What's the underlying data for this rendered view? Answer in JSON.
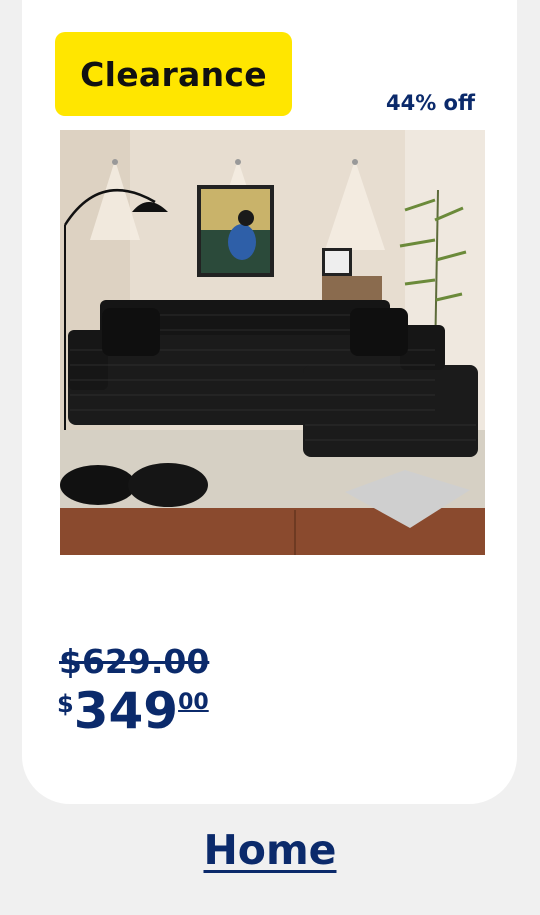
{
  "card": {
    "badge_label": "Clearance",
    "discount_text": "44% off",
    "product_image_alt": "Black corduroy L-shaped sectional sofa",
    "was_price": "$629.00",
    "now_price": {
      "currency": "$",
      "dollars": "349",
      "cents": "00"
    }
  },
  "category_link": "Home",
  "colors": {
    "badge_bg": "#ffe600",
    "text_blue": "#0b2a6b",
    "page_bg": "#f0f0f0"
  }
}
